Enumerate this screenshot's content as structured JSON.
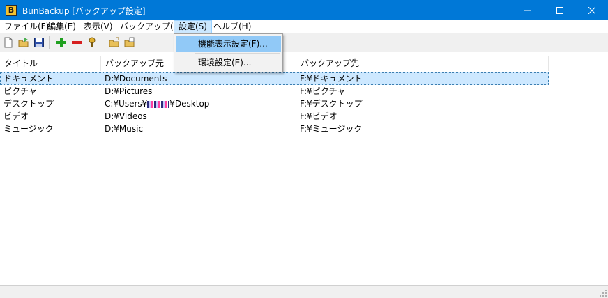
{
  "window": {
    "title": "BunBackup [バックアップ設定]",
    "app_icon": "bunbackup-icon"
  },
  "menubar": {
    "items": [
      {
        "label": "ファイル(F)"
      },
      {
        "label": "編集(E)"
      },
      {
        "label": "表示(V)"
      },
      {
        "label": "バックアップ(B)"
      },
      {
        "label": "設定(S)",
        "active": true
      },
      {
        "label": "ヘルプ(H)"
      }
    ]
  },
  "toolbar": {
    "buttons": [
      "new-file-icon",
      "open-folder-icon",
      "save-icon",
      "add-icon",
      "remove-icon",
      "properties-icon",
      "backup-folder-icon",
      "restore-folder-icon"
    ]
  },
  "settings_menu": {
    "items": [
      {
        "label": "機能表示設定(F)...",
        "highlighted": true
      },
      {
        "label": "環境設定(E)..."
      }
    ]
  },
  "list": {
    "columns": [
      "タイトル",
      "バックアップ元",
      "バックアップ先"
    ],
    "rows": [
      {
        "title": "ドキュメント",
        "source": "D:¥Documents",
        "dest": "F:¥ドキュメント",
        "selected": true
      },
      {
        "title": "ピクチャ",
        "source": "D:¥Pictures",
        "dest": "F:¥ピクチャ"
      },
      {
        "title": "デスクトップ",
        "source_prefix": "C:¥Users¥",
        "source_suffix": "¥Desktop",
        "dest": "F:¥デスクトップ"
      },
      {
        "title": "ビデオ",
        "source": "D:¥Videos",
        "dest": "F:¥ビデオ"
      },
      {
        "title": "ミュージック",
        "source": "D:¥Music",
        "dest": "F:¥ミュージック"
      }
    ]
  },
  "colors": {
    "titlebar": "#0078d7",
    "selection": "#cde8ff",
    "menu_highlight": "#91c9f7"
  }
}
